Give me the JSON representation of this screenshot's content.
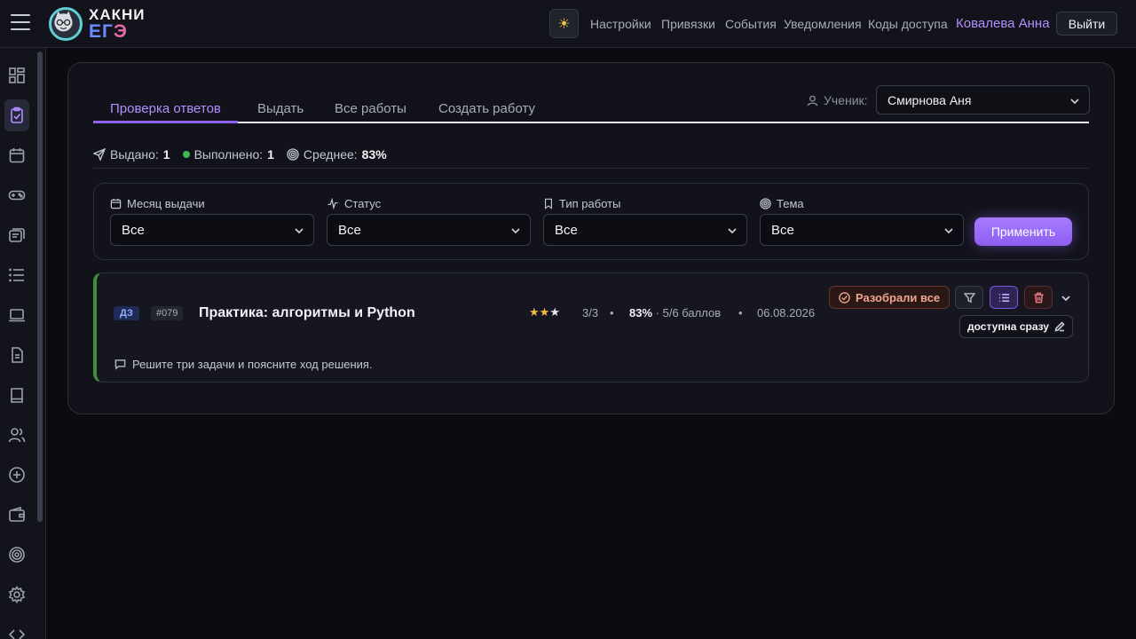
{
  "header": {
    "logo_line1": "ХАКНИ",
    "logo_line2a": "ЕГ",
    "logo_line2b": "Э",
    "nav": [
      "Настройки",
      "Привязки",
      "События",
      "Уведомления",
      "Коды доступа"
    ],
    "user_name": "Ковалева Анна",
    "logout_label": "Выйти",
    "accent_color": "#b48cff"
  },
  "tabs": {
    "items": [
      "Проверка ответов",
      "Выдать",
      "Все работы",
      "Создать работу"
    ],
    "active_index": 0
  },
  "student": {
    "label": "Ученик:",
    "value": "Смирнова Аня"
  },
  "stats": {
    "issued_label": "Выдано:",
    "issued_value": "1",
    "done_label": "Выполнено:",
    "done_value": "1",
    "avg_label": "Среднее:",
    "avg_value": "83%"
  },
  "filters": {
    "month": {
      "label": "Месяц выдачи",
      "value": "Все"
    },
    "status": {
      "label": "Статус",
      "value": "Все"
    },
    "type": {
      "label": "Тип работы",
      "value": "Все"
    },
    "topic": {
      "label": "Тема",
      "value": "Все"
    },
    "apply_label": "Применить"
  },
  "work": {
    "type_badge": "ДЗ",
    "number": "#079",
    "title": "Практика: алгоритмы и Python",
    "stars_filled": 2,
    "stars_total": 3,
    "progress": "3/3",
    "percent": "83%",
    "points": "· 5/6 баллов",
    "date": "06.08.2026",
    "status_badge": "Разобрали все",
    "availability": "доступна сразу",
    "description": "Решите три задачи и поясните ход решения.",
    "stripe_color": "#3e8e3a"
  }
}
